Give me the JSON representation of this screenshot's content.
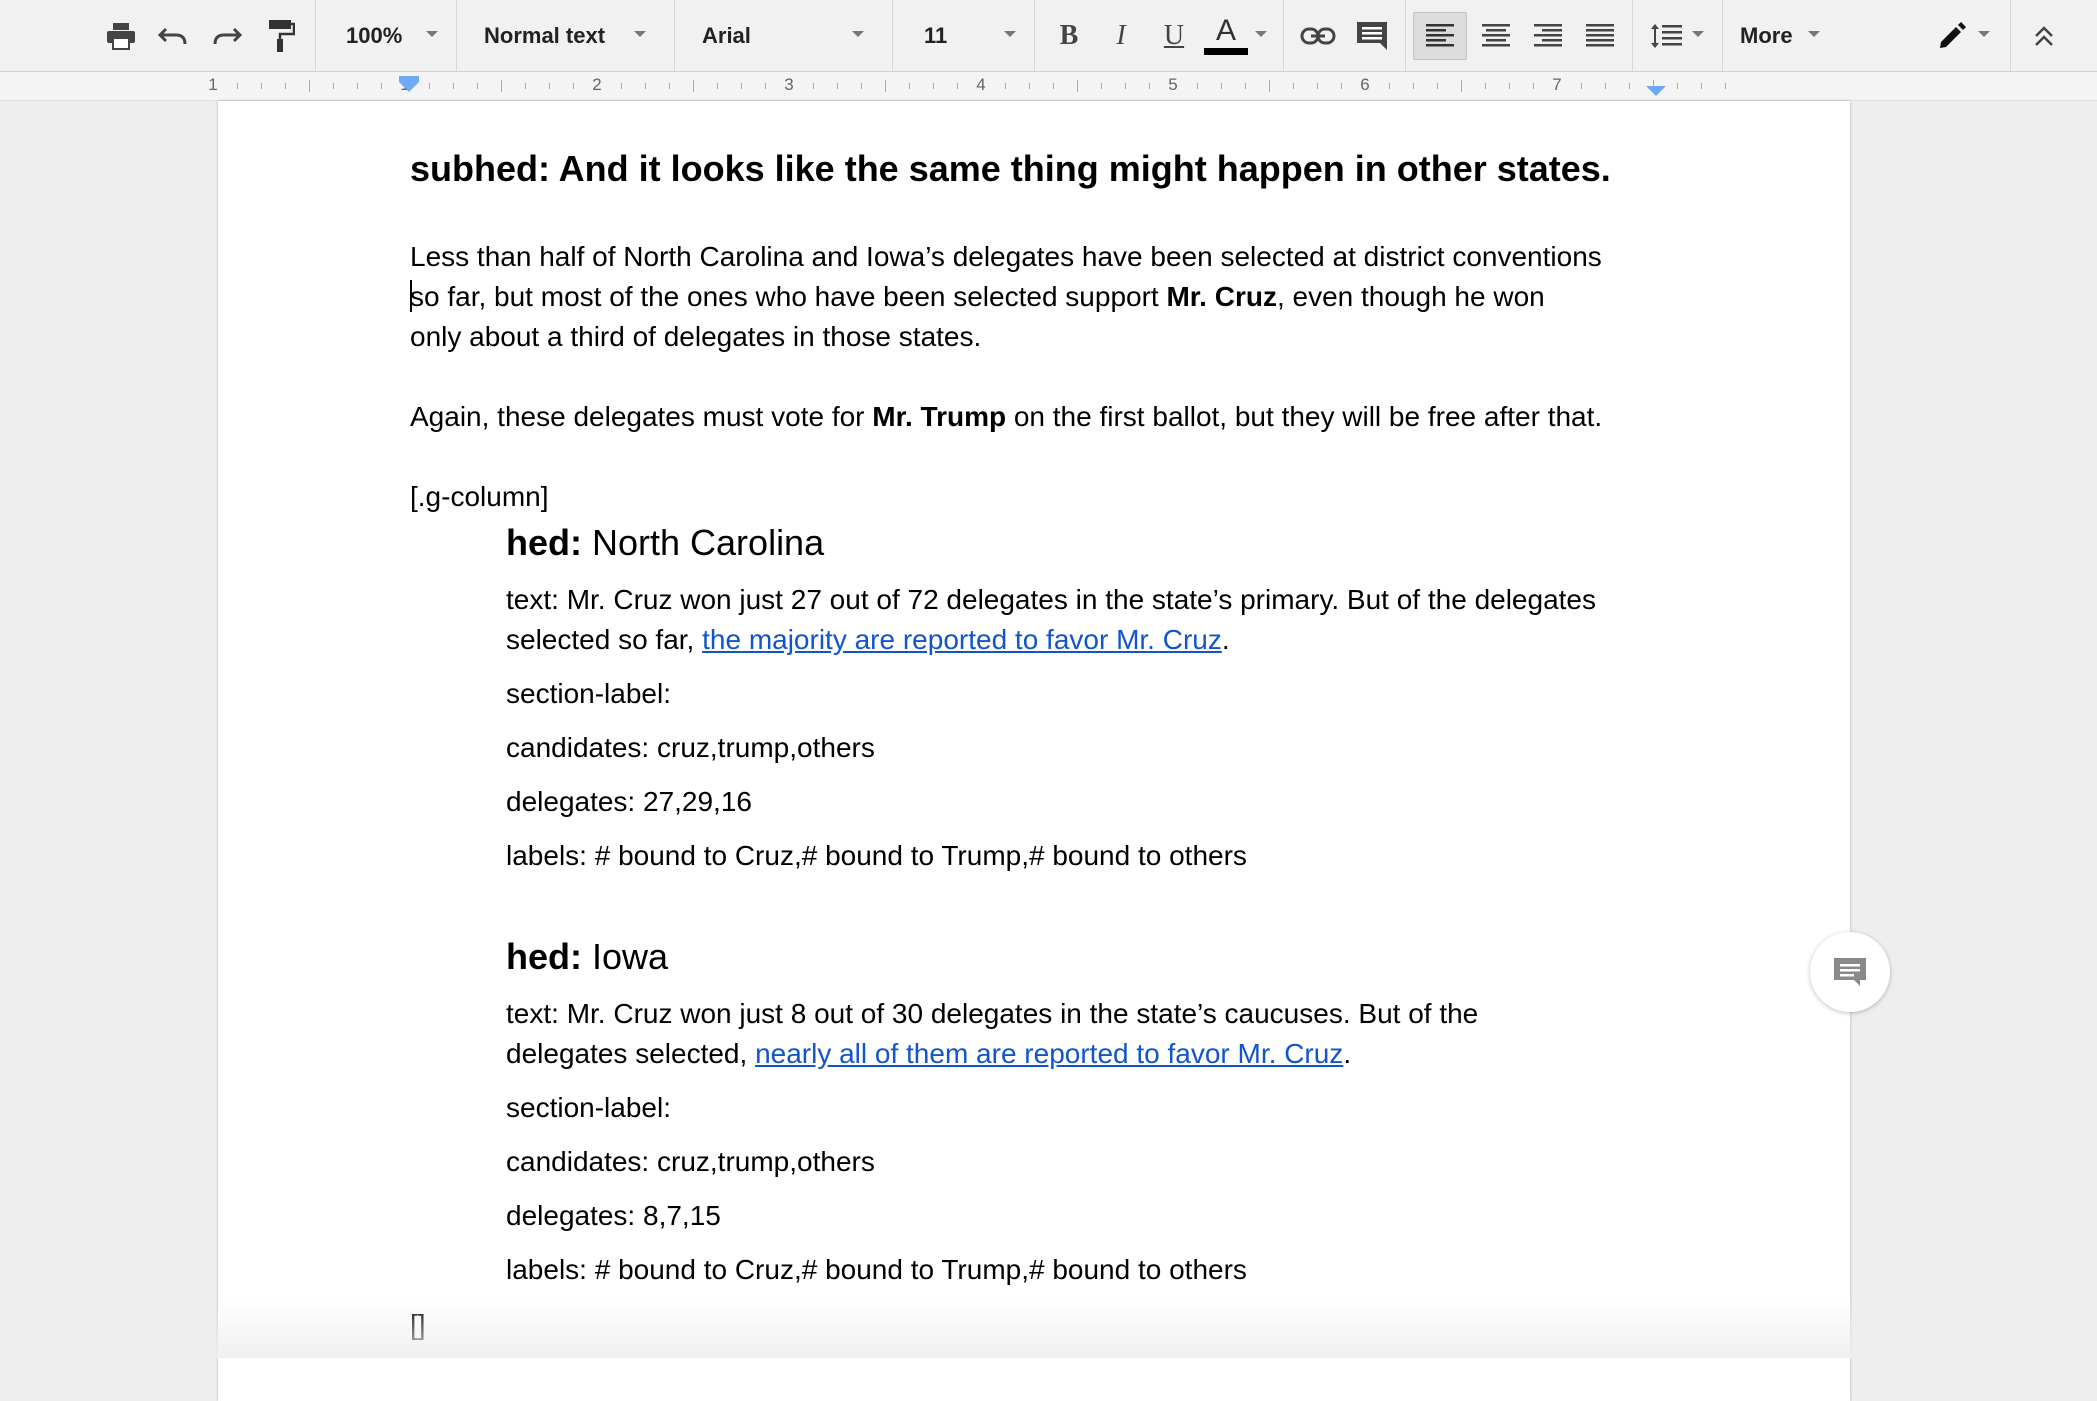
{
  "toolbar": {
    "print_icon": "printer-icon",
    "undo_icon": "undo-icon",
    "redo_icon": "redo-icon",
    "paint_format_icon": "paint-roller-icon",
    "zoom": "100%",
    "style": "Normal text",
    "font": "Arial",
    "font_size": "11",
    "bold_label": "B",
    "italic_label": "I",
    "underline_label": "U",
    "text_color_label": "A",
    "text_color": "#000000",
    "more_label": "More",
    "align_active": "left"
  },
  "ruler": {
    "numbers": [
      "1",
      "1",
      "2",
      "3",
      "4",
      "5",
      "6",
      "7"
    ]
  },
  "document": {
    "subhed": "subhed: And it looks like the same thing might happen in other states.",
    "para1": {
      "line1": "Less than half of North Carolina and Iowa’s delegates have been selected at district conventions",
      "line2_pre": "so far, but most of the ones who have been selected support ",
      "line2_bold": "Mr. Cruz",
      "line2_post": ", even though he won",
      "line3": "only about a third of delegates in those states."
    },
    "para2": {
      "pre": "Again, these delegates must vote for ",
      "bold": "Mr. Trump",
      "post": " on the first ballot, but they will be free after that."
    },
    "column_open": "[.g-column]",
    "sections": [
      {
        "hed_key": "hed:",
        "hed_value": " North Carolina",
        "text_line1": "text: Mr. Cruz won just 27 out of 72 delegates in the state’s primary. But of the delegates",
        "text_line2_pre": "selected so far, ",
        "text_link": "the majority are reported to favor Mr. Cruz",
        "text_line2_post": ".",
        "section_label": "section-label:",
        "candidates": "candidates: cruz,trump,others",
        "delegates": "delegates: 27,29,16",
        "labels": "labels: # bound to Cruz,# bound to Trump,# bound to others"
      },
      {
        "hed_key": "hed:",
        "hed_value": " Iowa",
        "text_line1": "text: Mr. Cruz won just 8 out of 30 delegates in the state’s caucuses. But of the",
        "text_line2_pre": "delegates selected, ",
        "text_link": "nearly all of them are reported to favor Mr. Cruz",
        "text_line2_post": ".",
        "section_label": "section-label:",
        "candidates": "candidates: cruz,trump,others",
        "delegates": "delegates: 8,7,15",
        "labels": "labels: # bound to Cruz,# bound to Trump,# bound to others"
      }
    ],
    "column_close": "[]"
  },
  "colors": {
    "link": "#1155cc",
    "ruler_marker": "#6fa8f5",
    "background": "#eeeeee",
    "toolbar_bg": "#f1f1f1"
  }
}
